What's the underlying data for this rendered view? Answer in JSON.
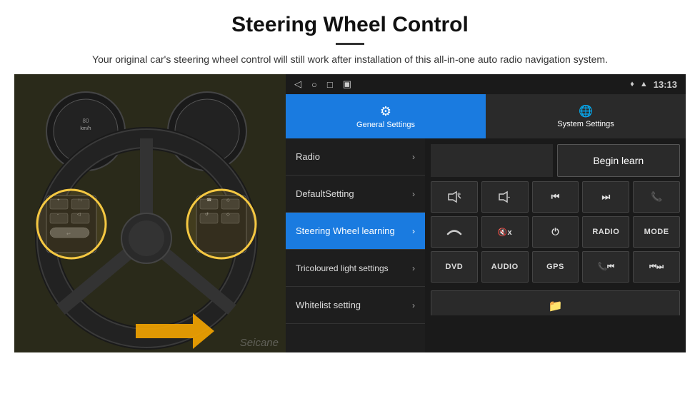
{
  "header": {
    "title": "Steering Wheel Control",
    "subtitle": "Your original car's steering wheel control will still work after installation of this all-in-one auto radio navigation system."
  },
  "android": {
    "statusBar": {
      "time": "13:13",
      "icons": [
        "◁",
        "○",
        "□",
        "▣"
      ]
    },
    "tabs": [
      {
        "id": "general",
        "label": "General Settings",
        "icon": "⚙",
        "active": true
      },
      {
        "id": "system",
        "label": "System Settings",
        "icon": "🌐",
        "active": false
      }
    ],
    "menu": [
      {
        "id": "radio",
        "label": "Radio",
        "active": false
      },
      {
        "id": "default",
        "label": "DefaultSetting",
        "active": false
      },
      {
        "id": "steering",
        "label": "Steering Wheel learning",
        "active": true
      },
      {
        "id": "tricoloured",
        "label": "Tricoloured light settings",
        "active": false
      },
      {
        "id": "whitelist",
        "label": "Whitelist setting",
        "active": false
      }
    ],
    "beginLearn": "Begin learn",
    "buttons": [
      [
        "🔊+",
        "🔊-",
        "⏮",
        "⏭",
        "📞"
      ],
      [
        "📞",
        "🔇x",
        "⏻",
        "RADIO",
        "MODE"
      ],
      [
        "DVD",
        "AUDIO",
        "GPS",
        "📞⏮",
        "⏮⏭"
      ]
    ]
  }
}
